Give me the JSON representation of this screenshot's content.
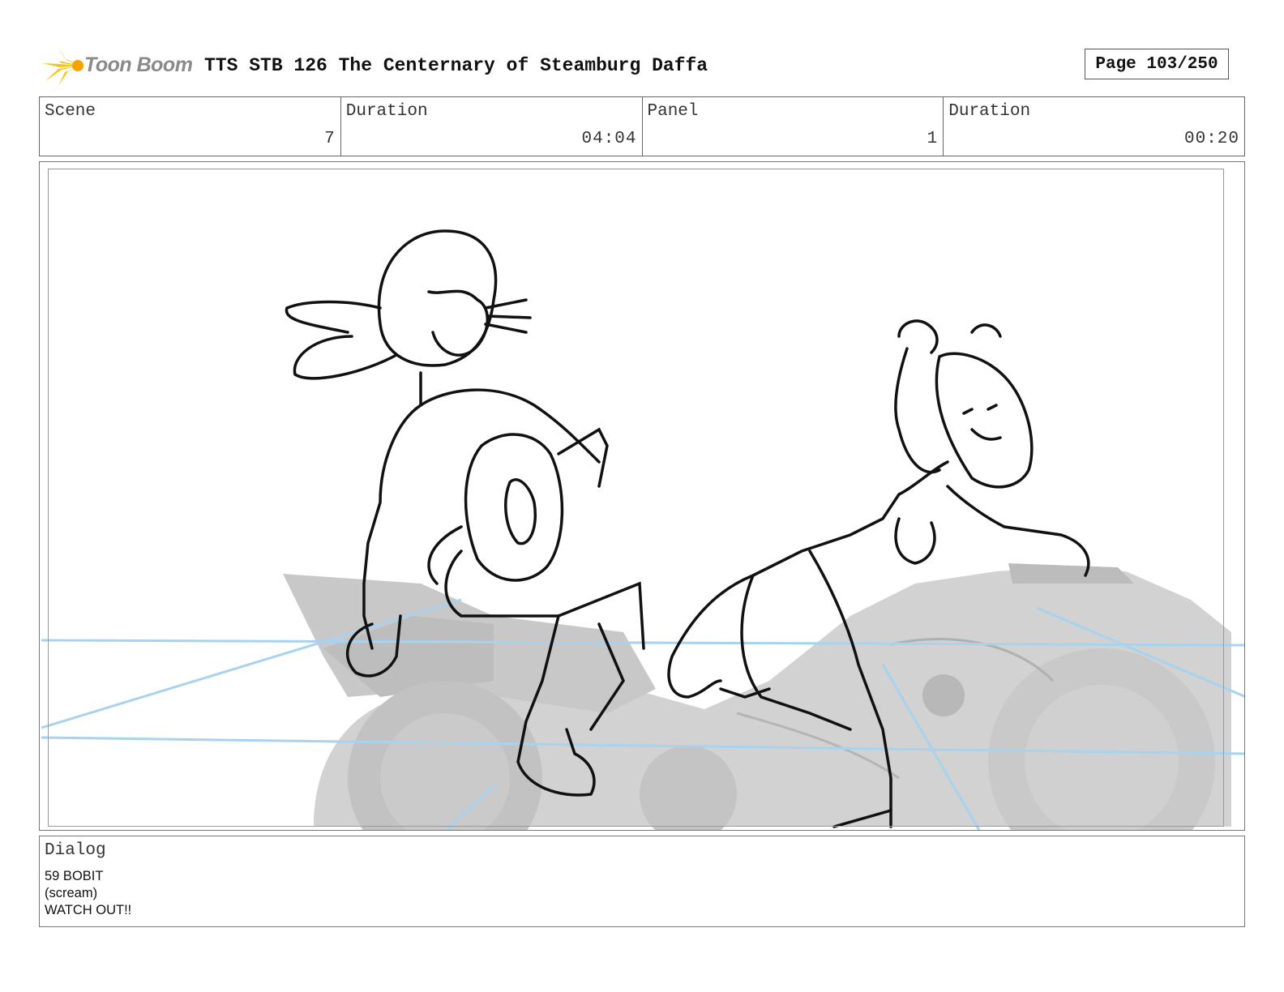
{
  "header": {
    "logo_text": "Toon Boom",
    "title": "TTS STB 126 The Centernary of Steamburg Daffa",
    "page": "Page 103/250"
  },
  "info": {
    "scene_label": "Scene",
    "scene_value": "7",
    "scene_duration_label": "Duration",
    "scene_duration_value": "04:04",
    "panel_label": "Panel",
    "panel_value": "1",
    "panel_duration_label": "Duration",
    "panel_duration_value": "00:20"
  },
  "dialog": {
    "label": "Dialog",
    "lines": [
      "59 BOBIT",
      "(scream)",
      "WATCH OUT!!"
    ]
  },
  "colors": {
    "logo_accent": "#f5c518",
    "guide_lines": "#a9d2ee",
    "vehicle_fill": "#cfcfcf"
  }
}
